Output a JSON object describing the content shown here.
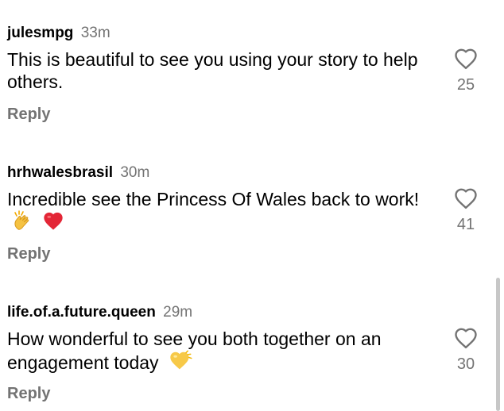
{
  "comments": [
    {
      "username": "julesmpg",
      "time": "33m",
      "text": "This is beautiful to see you using your story to help others.",
      "emojis": [],
      "likes": "25",
      "reply_label": "Reply"
    },
    {
      "username": "hrhwalesbrasil",
      "time": "30m",
      "text": "Incredible see the Princess Of Wales back to work!",
      "emojis": [
        "clapping-hands-emoji",
        "red-heart-emoji"
      ],
      "likes": "41",
      "reply_label": "Reply"
    },
    {
      "username": "life.of.a.future.queen",
      "time": "29m",
      "text": "How wonderful to see you both together on an engagement today",
      "emojis": [
        "yellow-heart-emoji"
      ],
      "likes": "30",
      "reply_label": "Reply"
    }
  ],
  "icons": {
    "like": "heart-outline-icon"
  },
  "colors": {
    "secondary_text": "#737373",
    "primary_text": "#000000",
    "heart_red": "#e0245e",
    "heart_yellow": "#f7c948"
  }
}
